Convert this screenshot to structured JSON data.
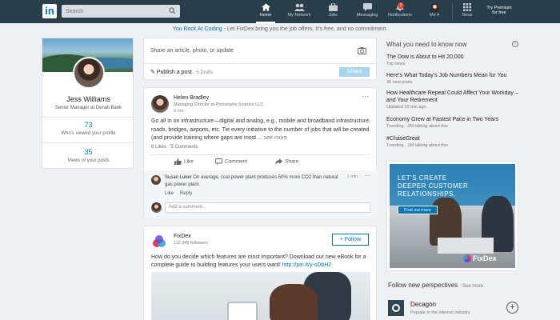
{
  "nav": {
    "logo": "in",
    "search_placeholder": "Search",
    "items": [
      {
        "label": "Home"
      },
      {
        "label": "My Network"
      },
      {
        "label": "Jobs"
      },
      {
        "label": "Messaging"
      },
      {
        "label": "Notifications",
        "badge": "2"
      },
      {
        "label": "Me"
      },
      {
        "label": "Nous"
      },
      {
        "label": "Try Premium",
        "label2": "for free"
      }
    ]
  },
  "promo": {
    "highlight": "You Rock At Coding",
    "text": " - Let FixDex bring you the job offers. It's free, and no commitment."
  },
  "profile": {
    "name": "Jess Williams",
    "title": "Senior Manager at Denali Bank",
    "views_count": "73",
    "views_label": "Who's viewed your profile",
    "post_views_count": "35",
    "post_views_label": "Views of your posts"
  },
  "share": {
    "placeholder": "Share an article, photo, or update",
    "publish_label": "Publish a post",
    "drafts": "· 5 Drafts",
    "share_button": "Share"
  },
  "post1": {
    "author": "Helen Bradley",
    "subtitle": "Managing Director at Philosophy Science LLC",
    "time": "3 hrs",
    "body": "Go all in on infrastructure—digital and analog, e.g., mobile and broadband infrastructure, roads, bridges, airports, etc. Tie every initiative to the number of jobs that will be created (and provide training where gaps are most ... ",
    "see_more": "see more",
    "counts": "8 Likes · 5 Comments",
    "actions": {
      "like": "Like",
      "comment": "Comment",
      "share": "Share"
    },
    "comment": {
      "author": "Susan Luker",
      "text": " On average, coal power plant produces 50% more CO2 than natural gas power plant.",
      "time": "1 min",
      "like": "Like",
      "reply": "Reply"
    },
    "add_comment_placeholder": "Add a comment..."
  },
  "post2": {
    "author": "FixDex",
    "subtitle": "112,345 followers",
    "follow_button": "+ Follow",
    "body": "How do you decide which features are most important? Download our new eBook for a complete guide to building features your users want! ",
    "link": "http://pin.it/y-sDbH2"
  },
  "right": {
    "heading": "What you need to know now",
    "news": [
      {
        "title": "The Dow is About to Hit 20,000",
        "meta": "Top news"
      },
      {
        "title": "Here's What Today's Job Numbers Mean for You",
        "meta": "36 new posts"
      },
      {
        "title": "How Healthcare Repeal Could Affect Your Workday – and Your Retirement",
        "meta": "Updated 10 min ago"
      },
      {
        "title": "Economy Grew at Fastest Pace in Two Years",
        "meta": "Trending  · 2M talking about this"
      },
      {
        "title": "#ChaseGreat",
        "meta": "Trending  · 1M talking about this"
      }
    ],
    "ad": {
      "line1": "LET'S CREATE",
      "line2": "DEEPER CUSTOMER",
      "line3": "RELATIONSHIPS.",
      "button": "Find out more",
      "brand": "FixDex"
    },
    "follow_heading": "Follow new perspectives",
    "see_more": "· See more",
    "suggestion": {
      "name": "Decagon",
      "sub": "Popular in the internet industry"
    }
  }
}
